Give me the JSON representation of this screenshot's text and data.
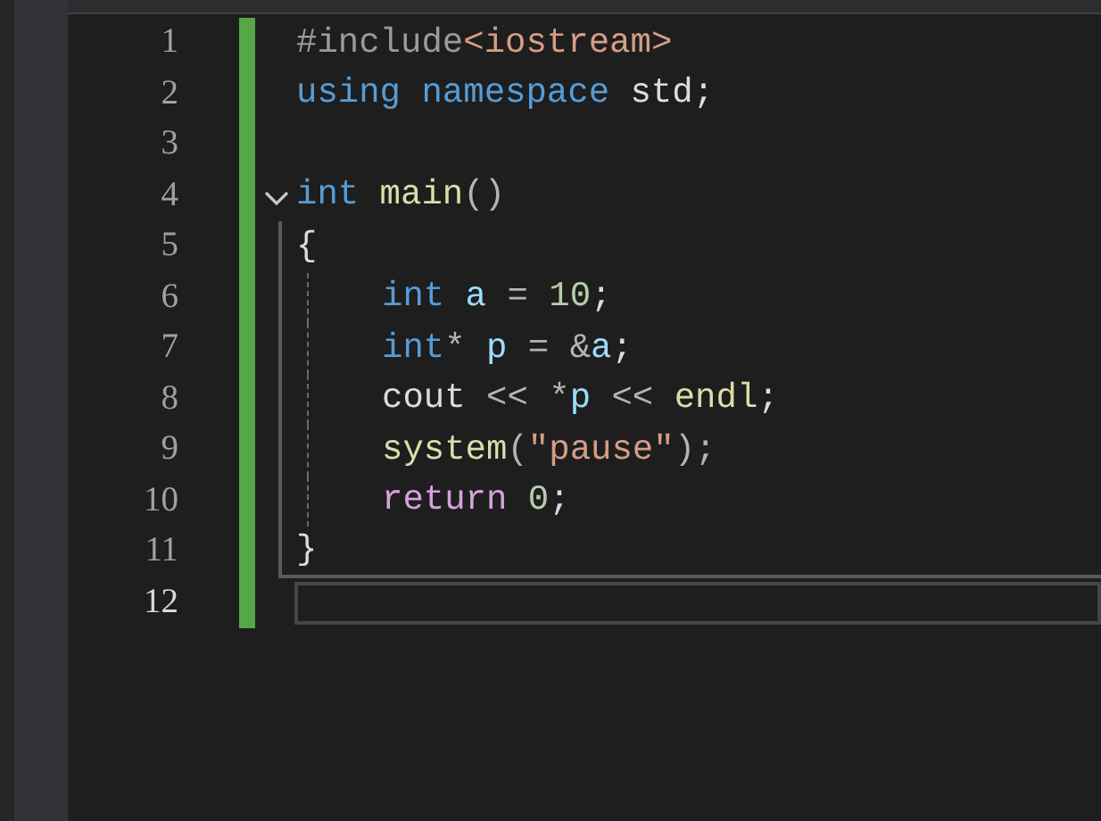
{
  "editor": {
    "lines": [
      {
        "number": "1",
        "current": false,
        "tokens": [
          {
            "kind": "preprocessor",
            "text": "#include"
          },
          {
            "kind": "include_path",
            "text": "<iostream>"
          }
        ]
      },
      {
        "number": "2",
        "current": false,
        "tokens": [
          {
            "kind": "keyword",
            "text": "using namespace"
          },
          {
            "kind": "plain",
            "text": " std;"
          }
        ]
      },
      {
        "number": "3",
        "current": false
      },
      {
        "number": "4",
        "current": false,
        "expanded": true,
        "tokens": [
          {
            "kind": "keyword",
            "text": "int"
          },
          {
            "kind": "function",
            "text": " main"
          },
          {
            "kind": "operator",
            "text": "()"
          }
        ],
        "children": [
          {
            "number": "5",
            "current": false,
            "tokens": [
              {
                "kind": "plain",
                "text": "{"
              }
            ]
          },
          {
            "number": "6",
            "current": false,
            "indented": true,
            "tokens": [
              {
                "kind": "keyword",
                "text": "int"
              },
              {
                "kind": "variable",
                "text": " a"
              },
              {
                "kind": "operator",
                "text": " = "
              },
              {
                "kind": "number",
                "text": "10"
              },
              {
                "kind": "plain",
                "text": ";"
              }
            ]
          },
          {
            "number": "7",
            "current": false,
            "indented": true,
            "tokens": [
              {
                "kind": "keyword",
                "text": "int"
              },
              {
                "kind": "operator",
                "text": "*"
              },
              {
                "kind": "variable",
                "text": " p"
              },
              {
                "kind": "operator",
                "text": " = &"
              },
              {
                "kind": "variable",
                "text": "a"
              },
              {
                "kind": "plain",
                "text": ";"
              }
            ]
          },
          {
            "number": "8",
            "current": false,
            "indented": true,
            "tokens": [
              {
                "kind": "plain",
                "text": "cout"
              },
              {
                "kind": "operator",
                "text": " << *"
              },
              {
                "kind": "variable",
                "text": "p"
              },
              {
                "kind": "operator",
                "text": " << "
              },
              {
                "kind": "function",
                "text": "endl"
              },
              {
                "kind": "plain",
                "text": ";"
              }
            ]
          },
          {
            "number": "9",
            "current": false,
            "indented": true,
            "tokens": [
              {
                "kind": "function",
                "text": "system"
              },
              {
                "kind": "operator",
                "text": "("
              },
              {
                "kind": "string",
                "text": "\"pause\""
              },
              {
                "kind": "operator",
                "text": ");"
              }
            ]
          },
          {
            "number": "10",
            "current": false,
            "indented": true,
            "tokens": [
              {
                "kind": "control",
                "text": "return"
              },
              {
                "kind": "number",
                "text": " 0"
              },
              {
                "kind": "plain",
                "text": ";"
              }
            ]
          },
          {
            "number": "11",
            "current": false,
            "tokens": [
              {
                "kind": "plain",
                "text": "}"
              }
            ]
          }
        ]
      },
      {
        "number": "12",
        "current": true
      }
    ]
  }
}
